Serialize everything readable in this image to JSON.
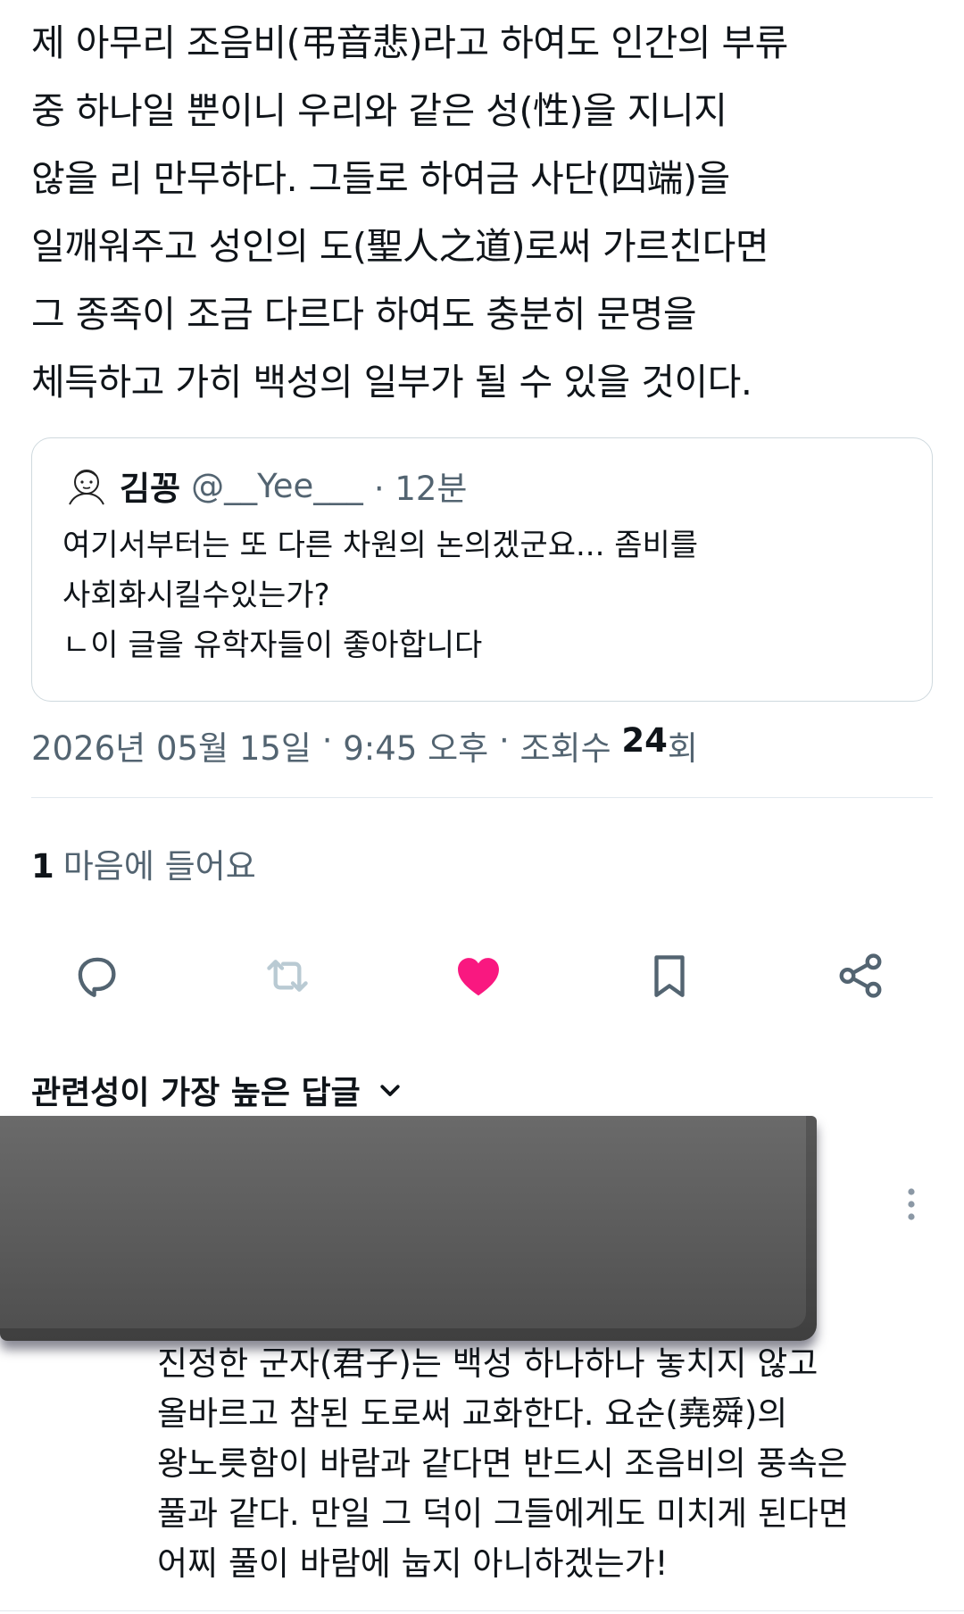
{
  "tweet": {
    "text": "제 아무리 조음비(弔音悲)라고 하여도 인간의 부류\n중 하나일 뿐이니 우리와 같은 성(性)을 지니지\n않을 리 만무하다. 그들로 하여금 사단(四端)을\n일깨워주고 성인의 도(聖人之道)로써 가르친다면\n그 종족이 조금 다르다 하여도 충분히 문명을\n체득하고 가히 백성의 일부가 될 수 있을 것이다."
  },
  "quote": {
    "name": "김꽁",
    "handle": "@__Yee___",
    "time": "· 12분",
    "text": "여기서부터는 또 다른 차원의 논의겠군요... 좀비를\n사회화시킬수있는가?\nㄴ이 글을 유학자들이 좋아합니다"
  },
  "meta": {
    "date": "2026년 05월 15일",
    "sep1": " · ",
    "time": "9:45 오후",
    "sep2": " · ",
    "views_label": "조회수 ",
    "views_count": "24",
    "views_suffix": "회"
  },
  "likes": {
    "count": "1",
    "label": "마음에 들어요"
  },
  "actions": {
    "reply": "reply-icon",
    "retweet": "retweet-icon",
    "like": "heart-icon",
    "bookmark": "bookmark-icon",
    "share": "share-icon",
    "liked_color": "#f91880",
    "icon_color": "#536471",
    "retweet_disabled_color": "#b9cad3"
  },
  "replies": {
    "sort_label": "관련성이 가장 높은 답글",
    "items": [
      {
        "text": "진정한 군자(君子)는 백성 하나하나 놓치지 않고\n올바르고 참된 도로써 교화한다. 요순(堯舜)의\n왕노릇함이 바람과 같다면 반드시 조음비의 풍속은\n풀과 같다. 만일 그 덕이 그들에게도 미치게 된다면\n어찌 풀이 바람에 눕지 아니하겠는가!"
      }
    ]
  }
}
